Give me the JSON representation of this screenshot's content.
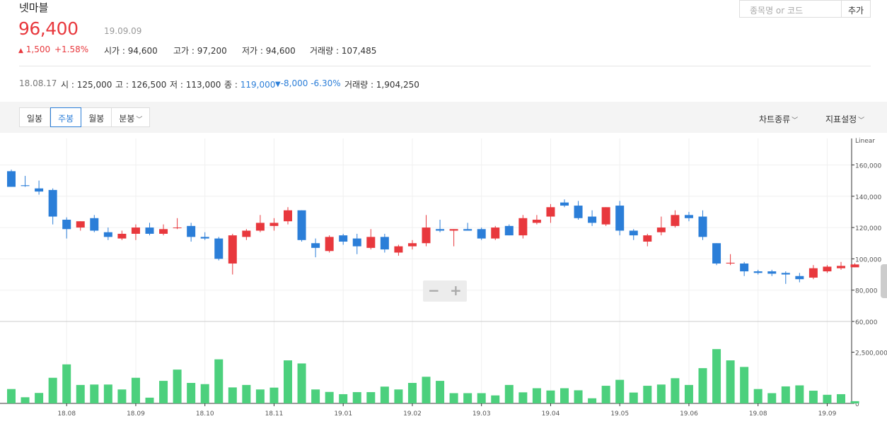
{
  "header": {
    "name": "넷마블",
    "price": "96,400",
    "date": "19.09.09",
    "change": "1,500",
    "change_pct": "+1.58%",
    "stats": [
      {
        "label": "시가",
        "value": "94,600"
      },
      {
        "label": "고가",
        "value": "97,200"
      },
      {
        "label": "저가",
        "value": "94,600"
      },
      {
        "label": "거래량",
        "value": "107,485"
      }
    ]
  },
  "search": {
    "placeholder": "종목명 or 코드",
    "button": "추가"
  },
  "history": {
    "date": "18.08.17",
    "open_label": "시",
    "open": "125,000",
    "high_label": "고",
    "high": "126,500",
    "low_label": "저",
    "low": "113,000",
    "close_label": "종",
    "close": "119,000",
    "change": "-8,000",
    "change_pct": "-6.30%",
    "volume_label": "거래량",
    "volume": "1,904,250"
  },
  "toolbar": {
    "tabs": [
      "일봉",
      "주봉",
      "월봉",
      "분봉"
    ],
    "active_tab": "주봉",
    "chart_type": "차트종류",
    "indicator": "지표설정"
  },
  "colors": {
    "up": "#e8383d",
    "down": "#2b7ed8",
    "volume": "#4cd07d"
  },
  "chart_data": {
    "type": "candlestick",
    "scale_label": "Linear",
    "price_ticks": [
      "160,000",
      "140,000",
      "120,000",
      "100,000",
      "80,000",
      "60,000"
    ],
    "volume_ticks": [
      "2,500,000",
      "0"
    ],
    "x_ticks": [
      "18.08",
      "18.09",
      "18.10",
      "18.11",
      "19.01",
      "19.02",
      "19.03",
      "19.04",
      "19.05",
      "19.06",
      "19.08",
      "19.09"
    ],
    "price_range": [
      60000,
      176000
    ],
    "volume_range": [
      0,
      4000000
    ],
    "candles": [
      {
        "o": 156000,
        "h": 157000,
        "l": 146000,
        "c": 146000,
        "v": 700000
      },
      {
        "o": 147000,
        "h": 153000,
        "l": 146000,
        "c": 146500,
        "v": 300000
      },
      {
        "o": 145000,
        "h": 150000,
        "l": 141000,
        "c": 143000,
        "v": 510000
      },
      {
        "o": 144000,
        "h": 145000,
        "l": 122000,
        "c": 127000,
        "v": 1250000
      },
      {
        "o": 125000,
        "h": 126500,
        "l": 113000,
        "c": 119000,
        "v": 1904250
      },
      {
        "o": 120000,
        "h": 124000,
        "l": 118000,
        "c": 124000,
        "v": 900000
      },
      {
        "o": 126000,
        "h": 128000,
        "l": 117000,
        "c": 118000,
        "v": 920000
      },
      {
        "o": 117000,
        "h": 120000,
        "l": 112000,
        "c": 114000,
        "v": 920000
      },
      {
        "o": 113000,
        "h": 118000,
        "l": 112000,
        "c": 116000,
        "v": 680000
      },
      {
        "o": 116000,
        "h": 122000,
        "l": 112000,
        "c": 120000,
        "v": 1250000
      },
      {
        "o": 120000,
        "h": 123000,
        "l": 115000,
        "c": 116000,
        "v": 280000
      },
      {
        "o": 116000,
        "h": 122000,
        "l": 115000,
        "c": 119000,
        "v": 1100000
      },
      {
        "o": 120000,
        "h": 126000,
        "l": 119000,
        "c": 120000,
        "v": 1650000
      },
      {
        "o": 121000,
        "h": 123000,
        "l": 111000,
        "c": 114000,
        "v": 1000000
      },
      {
        "o": 114000,
        "h": 117000,
        "l": 112000,
        "c": 113000,
        "v": 940000
      },
      {
        "o": 113000,
        "h": 114000,
        "l": 99000,
        "c": 100000,
        "v": 2150000
      },
      {
        "o": 97000,
        "h": 116000,
        "l": 90000,
        "c": 115000,
        "v": 780000
      },
      {
        "o": 114000,
        "h": 119000,
        "l": 112000,
        "c": 118000,
        "v": 900000
      },
      {
        "o": 118000,
        "h": 128000,
        "l": 117000,
        "c": 123000,
        "v": 680000
      },
      {
        "o": 121000,
        "h": 126000,
        "l": 118000,
        "c": 123000,
        "v": 770000
      },
      {
        "o": 124000,
        "h": 133000,
        "l": 122000,
        "c": 131000,
        "v": 2100000
      },
      {
        "o": 131000,
        "h": 131000,
        "l": 111000,
        "c": 112000,
        "v": 1950000
      },
      {
        "o": 110000,
        "h": 113000,
        "l": 101000,
        "c": 107000,
        "v": 680000
      },
      {
        "o": 105000,
        "h": 115000,
        "l": 104000,
        "c": 114000,
        "v": 560000
      },
      {
        "o": 115000,
        "h": 116000,
        "l": 109000,
        "c": 111000,
        "v": 450000
      },
      {
        "o": 113000,
        "h": 116000,
        "l": 103000,
        "c": 108000,
        "v": 550000
      },
      {
        "o": 107000,
        "h": 119000,
        "l": 106000,
        "c": 114000,
        "v": 550000
      },
      {
        "o": 114000,
        "h": 116000,
        "l": 104000,
        "c": 106000,
        "v": 820000
      },
      {
        "o": 104000,
        "h": 109000,
        "l": 102000,
        "c": 108000,
        "v": 680000
      },
      {
        "o": 108000,
        "h": 112000,
        "l": 106000,
        "c": 110000,
        "v": 1000000
      },
      {
        "o": 110000,
        "h": 128000,
        "l": 108000,
        "c": 120000,
        "v": 1300000
      },
      {
        "o": 119000,
        "h": 125000,
        "l": 117000,
        "c": 118000,
        "v": 1100000
      },
      {
        "o": 118000,
        "h": 119000,
        "l": 108000,
        "c": 119000,
        "v": 500000
      },
      {
        "o": 119000,
        "h": 123000,
        "l": 118000,
        "c": 118000,
        "v": 500000
      },
      {
        "o": 119000,
        "h": 120000,
        "l": 112000,
        "c": 113000,
        "v": 500000
      },
      {
        "o": 113000,
        "h": 121000,
        "l": 112000,
        "c": 120000,
        "v": 390000
      },
      {
        "o": 121000,
        "h": 122000,
        "l": 115000,
        "c": 115000,
        "v": 900000
      },
      {
        "o": 115000,
        "h": 128000,
        "l": 113000,
        "c": 126000,
        "v": 540000
      },
      {
        "o": 123000,
        "h": 128000,
        "l": 122000,
        "c": 125000,
        "v": 740000
      },
      {
        "o": 127000,
        "h": 135000,
        "l": 123000,
        "c": 133000,
        "v": 630000
      },
      {
        "o": 136000,
        "h": 138000,
        "l": 133000,
        "c": 134000,
        "v": 740000
      },
      {
        "o": 134000,
        "h": 137000,
        "l": 125000,
        "c": 126000,
        "v": 640000
      },
      {
        "o": 127000,
        "h": 131000,
        "l": 121000,
        "c": 123000,
        "v": 250000
      },
      {
        "o": 122000,
        "h": 133000,
        "l": 121000,
        "c": 133000,
        "v": 860000
      },
      {
        "o": 134000,
        "h": 137000,
        "l": 115000,
        "c": 118000,
        "v": 1150000
      },
      {
        "o": 118000,
        "h": 119000,
        "l": 112000,
        "c": 115000,
        "v": 530000
      },
      {
        "o": 111000,
        "h": 116000,
        "l": 108000,
        "c": 115000,
        "v": 860000
      },
      {
        "o": 117000,
        "h": 127000,
        "l": 115000,
        "c": 120000,
        "v": 920000
      },
      {
        "o": 121000,
        "h": 131000,
        "l": 120000,
        "c": 128000,
        "v": 1230000
      },
      {
        "o": 128000,
        "h": 130000,
        "l": 124000,
        "c": 126000,
        "v": 900000
      },
      {
        "o": 127000,
        "h": 131000,
        "l": 112000,
        "c": 114000,
        "v": 1720000
      },
      {
        "o": 110000,
        "h": 110000,
        "l": 96000,
        "c": 97000,
        "v": 2650000
      },
      {
        "o": 97000,
        "h": 103000,
        "l": 96000,
        "c": 97500,
        "v": 2100000
      },
      {
        "o": 97000,
        "h": 98000,
        "l": 89000,
        "c": 92000,
        "v": 1780000
      },
      {
        "o": 92000,
        "h": 93000,
        "l": 90000,
        "c": 91000,
        "v": 700000
      },
      {
        "o": 92000,
        "h": 93000,
        "l": 89000,
        "c": 90500,
        "v": 500000
      },
      {
        "o": 91000,
        "h": 92000,
        "l": 84000,
        "c": 90000,
        "v": 830000
      },
      {
        "o": 89000,
        "h": 91000,
        "l": 85000,
        "c": 87000,
        "v": 880000
      },
      {
        "o": 88000,
        "h": 96000,
        "l": 87000,
        "c": 94000,
        "v": 620000
      },
      {
        "o": 92000,
        "h": 96000,
        "l": 91000,
        "c": 95000,
        "v": 420000
      },
      {
        "o": 94000,
        "h": 98000,
        "l": 93000,
        "c": 95500,
        "v": 450000
      },
      {
        "o": 94600,
        "h": 97200,
        "l": 94600,
        "c": 96400,
        "v": 107485
      }
    ]
  }
}
